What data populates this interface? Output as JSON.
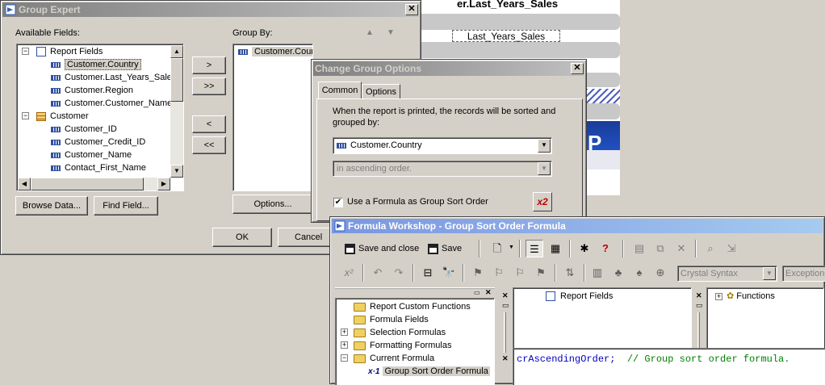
{
  "report_bg": {
    "header_text": "er.Last_Years_Sales",
    "field_text": "Last_Years_Sales"
  },
  "group_expert": {
    "title": "Group Expert",
    "available_label": "Available Fields:",
    "group_by_label": "Group By:",
    "tree": [
      {
        "label": "Report Fields",
        "kind": "root"
      },
      {
        "label": "Customer.Country",
        "kind": "field",
        "selected": true
      },
      {
        "label": "Customer.Last_Years_Sales",
        "kind": "field"
      },
      {
        "label": "Customer.Region",
        "kind": "field"
      },
      {
        "label": "Customer.Customer_Name",
        "kind": "field"
      },
      {
        "label": "Customer",
        "kind": "table"
      },
      {
        "label": "Customer_ID",
        "kind": "field"
      },
      {
        "label": "Customer_Credit_ID",
        "kind": "field"
      },
      {
        "label": "Customer_Name",
        "kind": "field"
      },
      {
        "label": "Contact_First_Name",
        "kind": "field"
      }
    ],
    "group_by_items": [
      "Customer.Country - A"
    ],
    "btn_add": ">",
    "btn_add_all": ">>",
    "btn_remove": "<",
    "btn_remove_all": "<<",
    "browse_data": "Browse Data...",
    "find_field": "Find Field...",
    "options": "Options...",
    "ok": "OK",
    "cancel": "Cancel"
  },
  "change_group": {
    "title": "Change Group Options",
    "tabs": [
      "Common",
      "Options"
    ],
    "description": "When the report is printed, the records will be sorted and grouped by:",
    "field_value": "Customer.Country",
    "order_value": "in ascending order.",
    "formula_checkbox_label": "Use a Formula as Group Sort Order",
    "formula_checked": true
  },
  "formula_workshop": {
    "title": "Formula Workshop - Group Sort Order Formula",
    "save_close": "Save and close",
    "save": "Save",
    "syntax": "Crystal Syntax",
    "exceptions": "Exceptions",
    "tree": [
      {
        "label": "Report Custom Functions",
        "expander": ""
      },
      {
        "label": "Formula Fields",
        "expander": ""
      },
      {
        "label": "Selection Formulas",
        "expander": "+"
      },
      {
        "label": "Formatting Formulas",
        "expander": "+"
      },
      {
        "label": "Current Formula",
        "expander": "-"
      },
      {
        "label": "Group Sort Order Formula",
        "expander": "",
        "selected": true
      }
    ],
    "report_fields": "Report Fields",
    "functions": "Functions",
    "code_keyword": "crAscendingOrder;",
    "code_comment": "// Group sort order formula."
  }
}
